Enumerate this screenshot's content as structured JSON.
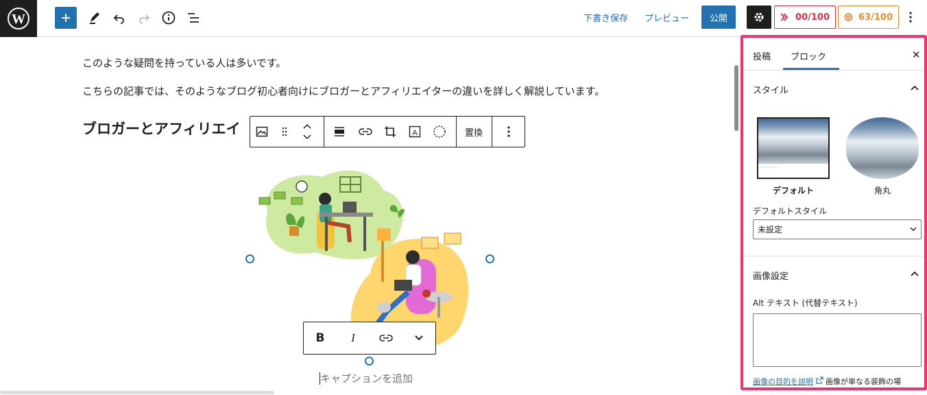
{
  "topbar": {
    "save_draft": "下書き保存",
    "preview": "プレビュー",
    "publish": "公開",
    "score1": "00/100",
    "score2": "63/100",
    "accent": "#2271b1"
  },
  "content": {
    "para1": "このような疑問を持っている人は多いです。",
    "para2": "こちらの記事では、そのようなブログ初心者向けにブロガーとアフィリエイターの違いを詳しく解説しています。",
    "heading": "ブロガーとアフィリエイ",
    "caption_placeholder": "キャプションを追加"
  },
  "block_toolbar": {
    "replace": "置換"
  },
  "format_toolbar": {
    "bold": "B",
    "italic": "I"
  },
  "sidebar": {
    "tab_post": "投稿",
    "tab_block": "ブロック",
    "style_section": "スタイル",
    "style_default": "デフォルト",
    "style_rounded": "角丸",
    "default_style_label": "デフォルトスタイル",
    "default_style_value": "未設定",
    "image_settings": "画像設定",
    "alt_label": "Alt テキスト (代替テキスト)",
    "help_link": "画像の目的を説明",
    "help_text": "画像が単なる装飾の場",
    "highlight_color": "#f4306f"
  }
}
